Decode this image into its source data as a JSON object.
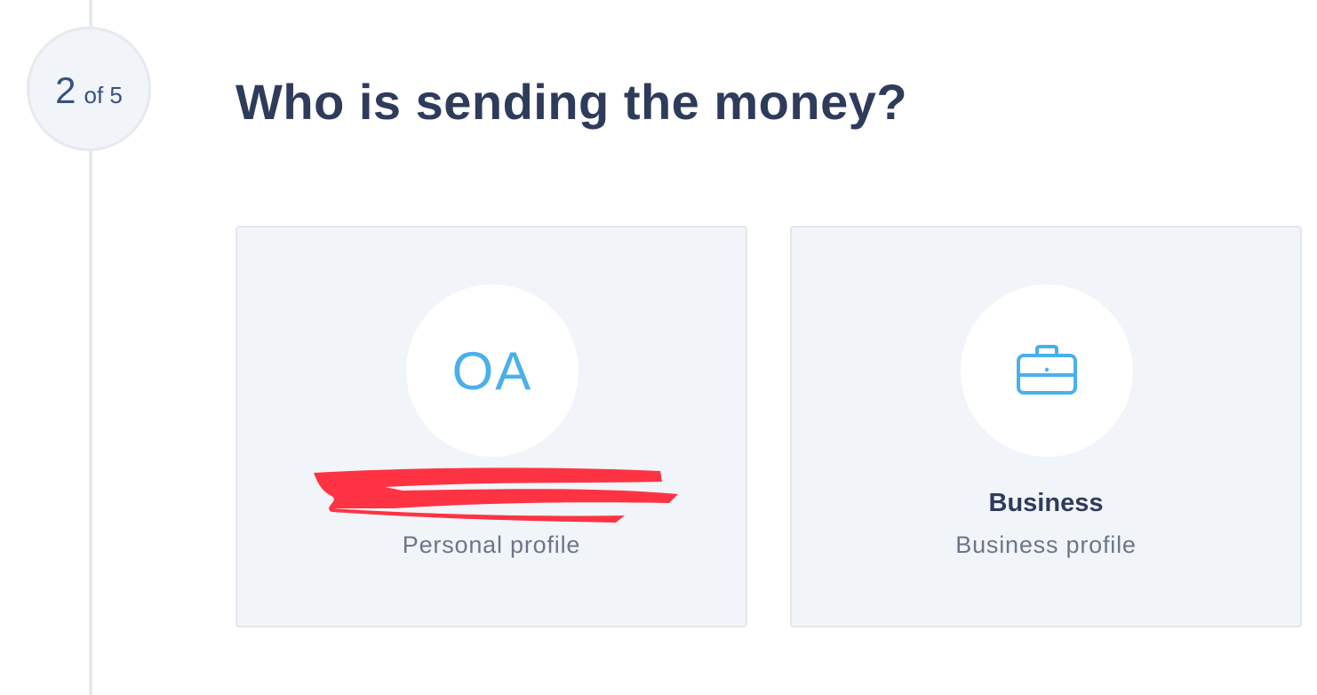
{
  "step": {
    "current": "2",
    "of_label": "of 5"
  },
  "title": "Who is sending the money?",
  "cards": [
    {
      "initials": "OA",
      "subtitle": "Personal profile"
    },
    {
      "icon": "briefcase-icon",
      "title": "Business",
      "subtitle": "Business profile"
    }
  ],
  "colors": {
    "heading": "#2e3b5b",
    "accent": "#4ab0ea",
    "card_bg": "#f1f4f8",
    "muted_text": "#6b7688",
    "redaction": "#fd3344"
  }
}
